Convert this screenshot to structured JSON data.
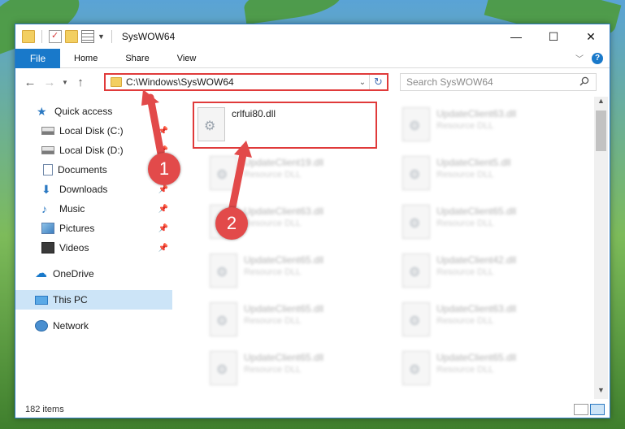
{
  "window": {
    "title": "SysWOW64",
    "controls": {
      "minimize": "—",
      "maximize": "☐",
      "close": "✕"
    }
  },
  "ribbon": {
    "tabs": [
      "File",
      "Home",
      "Share",
      "View"
    ]
  },
  "navigation": {
    "address": "C:\\Windows\\SysWOW64",
    "search_placeholder": "Search SysWOW64"
  },
  "sidebar": {
    "items": [
      {
        "label": "Quick access",
        "icon": "star-icon"
      },
      {
        "label": "Local Disk (C:)",
        "icon": "disk-icon",
        "pinned": true
      },
      {
        "label": "Local Disk (D:)",
        "icon": "disk-icon",
        "pinned": true
      },
      {
        "label": "Documents",
        "icon": "documents-icon",
        "pinned": true
      },
      {
        "label": "Downloads",
        "icon": "download-icon",
        "pinned": true
      },
      {
        "label": "Music",
        "icon": "music-icon",
        "pinned": true
      },
      {
        "label": "Pictures",
        "icon": "pictures-icon",
        "pinned": true
      },
      {
        "label": "Videos",
        "icon": "videos-icon",
        "pinned": true
      },
      {
        "label": "OneDrive",
        "icon": "cloud-icon"
      },
      {
        "label": "This PC",
        "icon": "pc-icon",
        "selected": true
      },
      {
        "label": "Network",
        "icon": "network-icon"
      }
    ]
  },
  "files": [
    {
      "name": "crlfui80.dll",
      "type": "",
      "blurred": false
    },
    {
      "name": "UpdateClient63.dll",
      "type": "Resource DLL",
      "blurred": true
    },
    {
      "name": "UpdateClient19.dll",
      "type": "Resource DLL",
      "blurred": true
    },
    {
      "name": "UpdateClient5.dll",
      "type": "Resource DLL",
      "blurred": true
    },
    {
      "name": "UpdateClient63.dll",
      "type": "Resource DLL",
      "blurred": true
    },
    {
      "name": "UpdateClient65.dll",
      "type": "Resource DLL",
      "blurred": true
    },
    {
      "name": "UpdateClient65.dll",
      "type": "Resource DLL",
      "blurred": true
    },
    {
      "name": "UpdateClient42.dll",
      "type": "Resource DLL",
      "blurred": true
    },
    {
      "name": "UpdateClient65.dll",
      "type": "Resource DLL",
      "blurred": true
    },
    {
      "name": "UpdateClient63.dll",
      "type": "Resource DLL",
      "blurred": true
    },
    {
      "name": "UpdateClient65.dll",
      "type": "Resource DLL",
      "blurred": true
    },
    {
      "name": "UpdateClient65.dll",
      "type": "Resource DLL",
      "blurred": true
    }
  ],
  "status": {
    "count": "182 items"
  },
  "annotations": {
    "step1": "1",
    "step2": "2"
  },
  "colors": {
    "accent": "#1979ca",
    "highlight": "#e03a3a",
    "selected": "#cce4f7"
  }
}
